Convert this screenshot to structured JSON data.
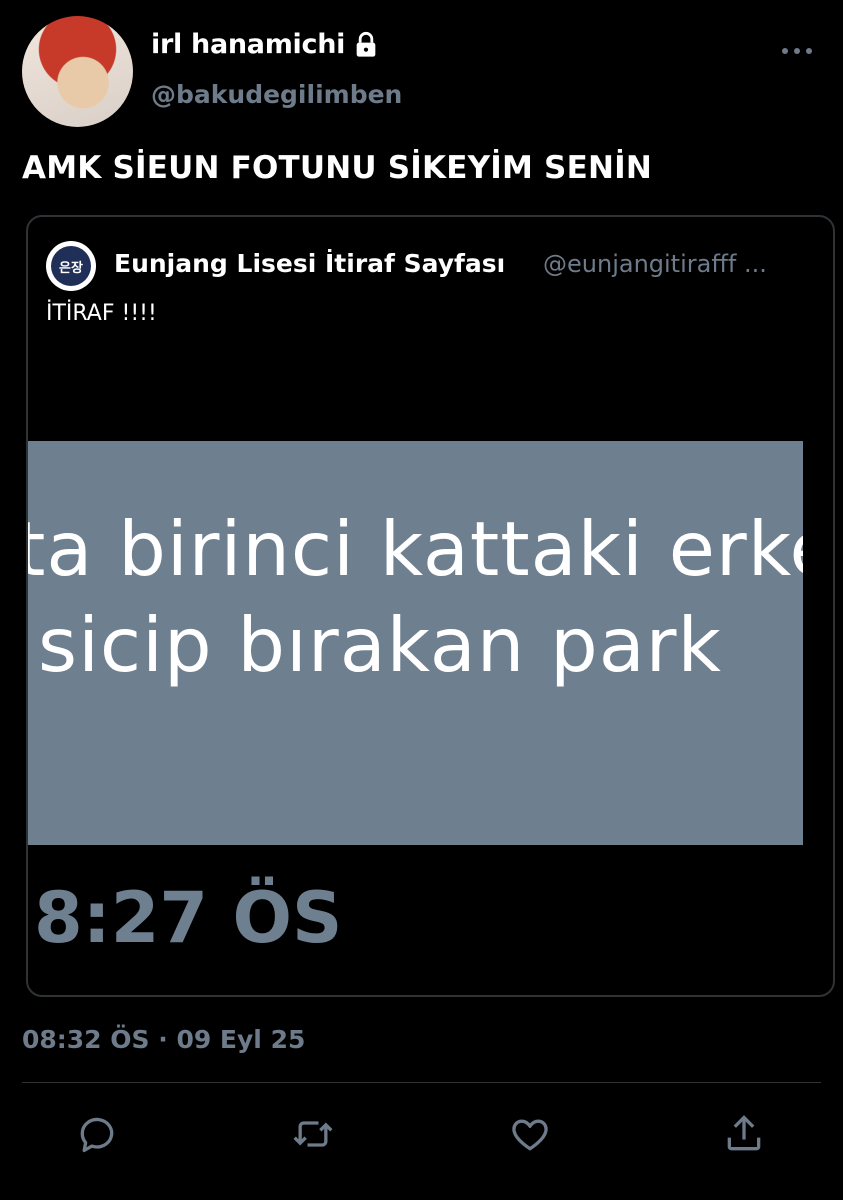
{
  "author": {
    "display_name": "irl hanamichi",
    "handle": "@bakudegilimben",
    "avatar_icon": "avatar",
    "lock_icon": "lock-icon"
  },
  "tweet": {
    "text": "AMK SİEUN FOTUNU SİKEYİM SENİN",
    "timestamp": "08:32 ÖS · 09 Eyl 25"
  },
  "quote": {
    "display_name": "Eunjang Lisesi İtiraf Sayfası",
    "handle": "@eunjangitirafff ...",
    "avatar_text": "은장",
    "text": "İTİRAF !!!!",
    "image": {
      "line1": "ta birinci kattaki erke",
      "line2": "sicip bırakan park",
      "time": ")8:27 ÖS"
    }
  },
  "actions": [
    "reply-icon",
    "retweet-icon",
    "like-icon",
    "share-icon"
  ],
  "colors": {
    "background": "#000000",
    "muted": "#6e7b8a",
    "image_bg": "#6e7f90"
  }
}
